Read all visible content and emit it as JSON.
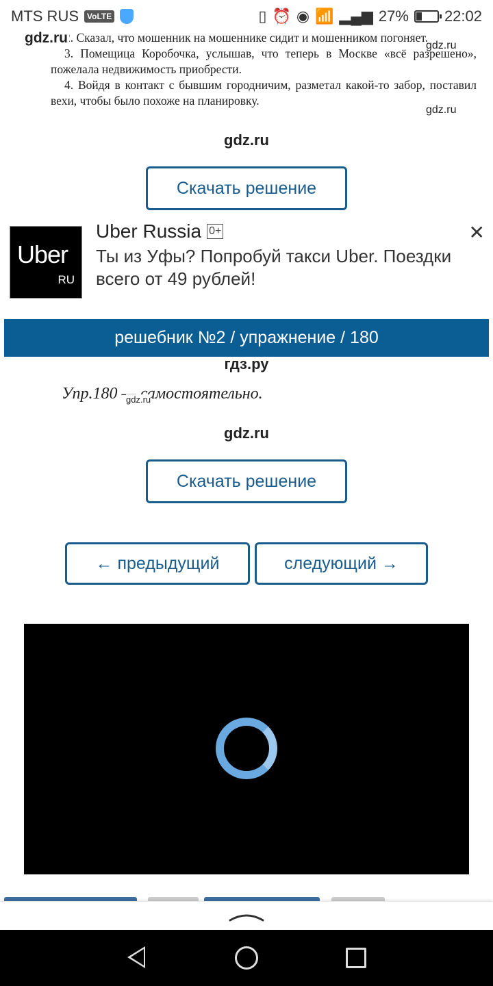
{
  "status_bar": {
    "carrier": "MTS RUS",
    "volte": "VoLTE",
    "battery_percent_label": "27%",
    "battery_level": 0.27,
    "time": "22:02",
    "icons": [
      "vibrate-icon",
      "alarm-icon",
      "eye-icon",
      "wifi-icon",
      "signal-icon",
      "battery-icon"
    ]
  },
  "document_top": {
    "line1": "2. Сказал, что мошенник на мошеннике сидит и мошенником погоняет.",
    "item3": "3. Помещица Коробочка, услышав, что теперь в Москве «всё разрешено», пожелала недвижимость приобрести.",
    "item4": "4. Войдя в контакт с бывшим городничим, разметал какой-то забор, поставил вехи, чтобы было похоже на планировку.",
    "watermark_bold": "gdz.ru",
    "watermark_small": "gdz.ru"
  },
  "watermark_center": "gdz.ru",
  "download_button": "Скачать решение",
  "ad": {
    "logo_main": "Uber",
    "logo_sub": "RU",
    "title": "Uber Russia",
    "age": "0+",
    "text": "Ты из Уфы? Попробуй такси Uber. Поездки всего от 49 рублей!",
    "close": "✕"
  },
  "section_header": "решебник №2 / упражнение / 180",
  "answer": {
    "watermark_cyr": "гдз.ру",
    "text": "Упр.180 — самостоятельно.",
    "inline_watermark": "gdz.ru"
  },
  "navigation": {
    "prev": "← предыдущий",
    "next": "следующий →"
  },
  "bottom": {
    "drawer_icon": "chevron-up-icon"
  },
  "colors": {
    "accent": "#1a5c8c",
    "band": "#0b5e94",
    "spinner": "#6aa8e0"
  }
}
